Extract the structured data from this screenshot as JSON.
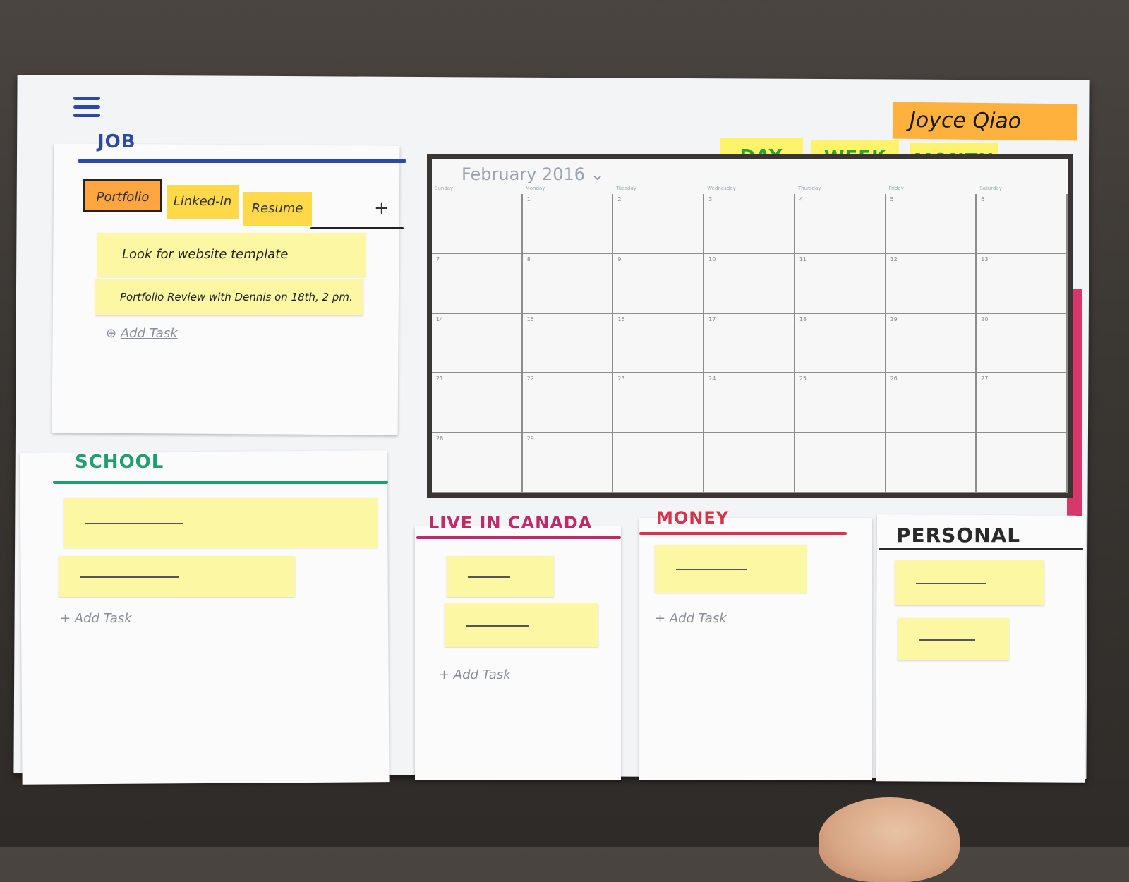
{
  "header": {
    "user_name": "Joyce Qiao",
    "view_buttons": [
      "DAY",
      "WEEK",
      "MONTH"
    ],
    "active_view": "MONTH"
  },
  "calendar": {
    "title": "February 2016 ⌄",
    "weekdays": [
      "Sunday",
      "Monday",
      "Tuesday",
      "Wednesday",
      "Thursday",
      "Friday",
      "Saturday"
    ],
    "days": [
      "",
      "1",
      "2",
      "3",
      "4",
      "5",
      "6",
      "7",
      "8",
      "9",
      "10",
      "11",
      "12",
      "13",
      "14",
      "15",
      "16",
      "17",
      "18",
      "19",
      "20",
      "21",
      "22",
      "23",
      "24",
      "25",
      "26",
      "27",
      "28",
      "29",
      "",
      "",
      "",
      "",
      ""
    ]
  },
  "job": {
    "title": "JOB",
    "tabs": [
      "Portfolio",
      "Linked-In",
      "Resume"
    ],
    "add_tab": "+",
    "tasks": [
      "Look for website template",
      "Portfolio Review with Dennis on 18th, 2 pm."
    ],
    "add_task": "Add Task"
  },
  "school": {
    "title": "SCHOOL",
    "add_task": "+ Add Task"
  },
  "canada": {
    "title": "LIVE IN CANADA",
    "add_task": "+ Add Task"
  },
  "money": {
    "title": "MONEY",
    "add_task": "+ Add Task"
  },
  "personal": {
    "title": "PERSONAL"
  },
  "colors": {
    "job": "#2e48a6",
    "school": "#1f9e6f",
    "canada": "#c02a66",
    "money": "#d8334a",
    "personal": "#2a2a2a",
    "sticky": "#fbf7a3",
    "tab_active": "#ffa640",
    "tab": "#ffd94a",
    "view_btn": "#fff36a",
    "view_text": "#2aa438"
  }
}
